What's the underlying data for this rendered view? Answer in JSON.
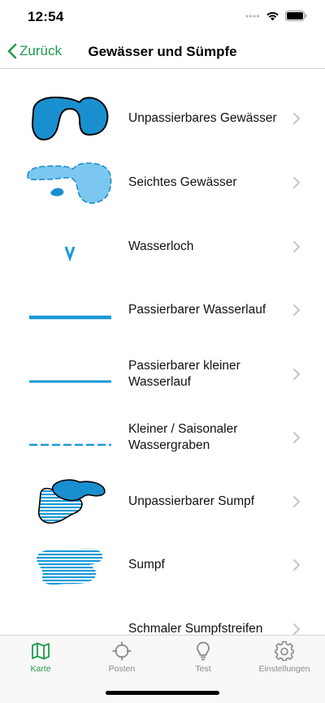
{
  "status_bar": {
    "time": "12:54"
  },
  "nav": {
    "back_label": "Zurück",
    "title": "Gewässer und Sümpfe"
  },
  "colors": {
    "accent": "#1f9b4b",
    "water_dark": "#1a8fd0",
    "water_light": "#7cc7f0",
    "line": "#1a9ad6"
  },
  "items": [
    {
      "label": "Unpassierbares Gewässer",
      "symbol": "impassable-water-icon"
    },
    {
      "label": "Seichtes Gewässer",
      "symbol": "shallow-water-icon"
    },
    {
      "label": "Wasserloch",
      "symbol": "waterhole-icon"
    },
    {
      "label": "Passierbarer Wasserlauf",
      "symbol": "crossable-watercourse-icon"
    },
    {
      "label": "Passierbarer kleiner Wasserlauf",
      "symbol": "small-crossable-watercourse-icon"
    },
    {
      "label": "Kleiner / Saisonaler Wassergraben",
      "symbol": "minor-ditch-icon"
    },
    {
      "label": "Unpassierbarer Sumpf",
      "symbol": "impassable-marsh-icon"
    },
    {
      "label": "Sumpf",
      "symbol": "marsh-icon"
    },
    {
      "label": "Schmaler Sumpfstreifen",
      "symbol": "narrow-marsh-icon"
    }
  ],
  "tabs": [
    {
      "label": "Karte",
      "icon": "map-icon",
      "active": true
    },
    {
      "label": "Posten",
      "icon": "crosshair-icon",
      "active": false
    },
    {
      "label": "Test",
      "icon": "lightbulb-icon",
      "active": false
    },
    {
      "label": "Einstellungen",
      "icon": "gear-icon",
      "active": false
    }
  ]
}
